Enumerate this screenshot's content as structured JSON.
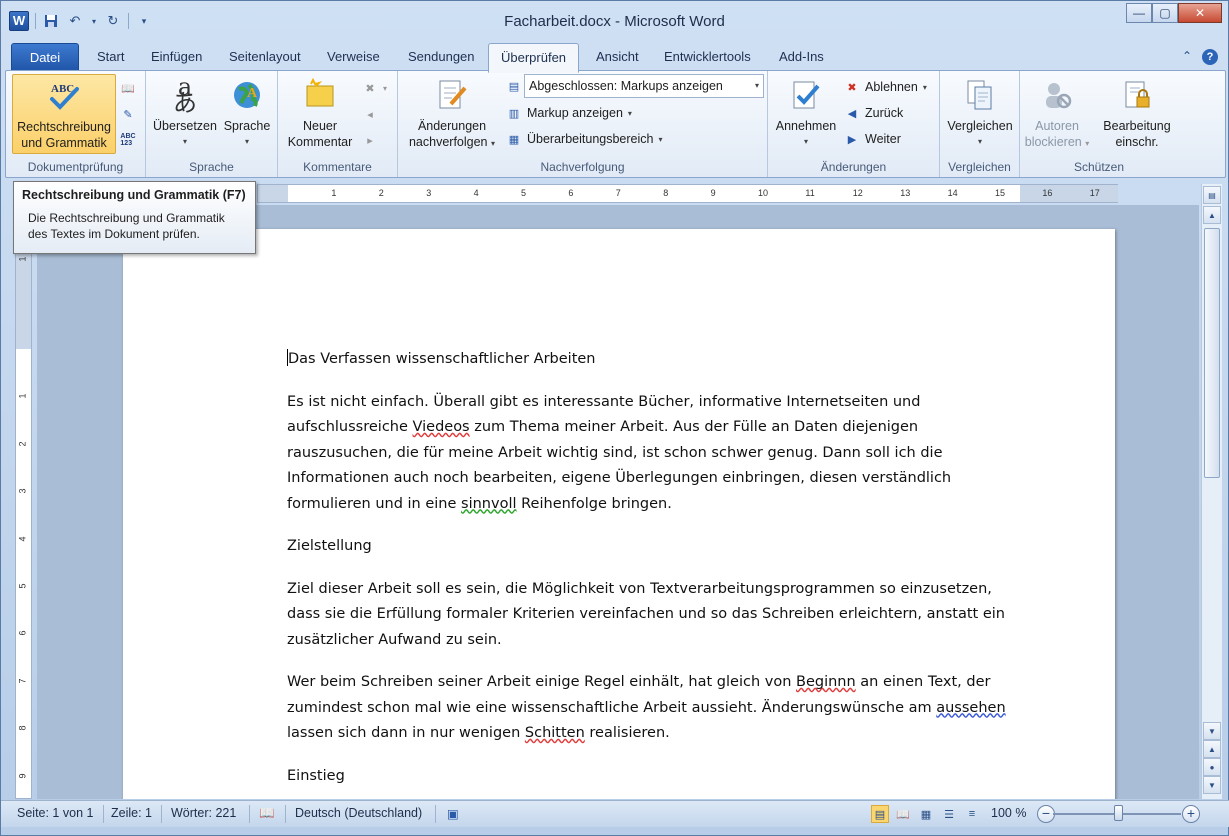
{
  "window": {
    "title": "Facharbeit.docx  -  Microsoft Word"
  },
  "qat": {
    "logo": "W",
    "save_icon": "save-icon",
    "undo_icon": "undo-icon",
    "redo_icon": "redo-icon"
  },
  "tabs": [
    "Datei",
    "Start",
    "Einfügen",
    "Seitenlayout",
    "Verweise",
    "Sendungen",
    "Überprüfen",
    "Ansicht",
    "Entwicklertools",
    "Add-Ins"
  ],
  "active_tab": "Überprüfen",
  "ribbon": {
    "dokumentpruefung": {
      "label": "Dokumentprüfung",
      "spell_label_1": "Rechtschreibung",
      "spell_label_2": "und Grammatik"
    },
    "sprache": {
      "label": "Sprache",
      "translate": "Übersetzen",
      "language": "Sprache"
    },
    "kommentare": {
      "label": "Kommentare",
      "new_1": "Neuer",
      "new_2": "Kommentar"
    },
    "nachverfolgung": {
      "label": "Nachverfolgung",
      "track_1": "Änderungen",
      "track_2": "nachverfolgen",
      "display_value": "Abgeschlossen: Markups anzeigen",
      "markup": "Markup anzeigen",
      "pane": "Überarbeitungsbereich"
    },
    "aenderungen": {
      "label": "Änderungen",
      "accept": "Annehmen",
      "reject": "Ablehnen",
      "previous": "Zurück",
      "next": "Weiter"
    },
    "vergleichen": {
      "label": "Vergleichen",
      "compare": "Vergleichen"
    },
    "schuetzen": {
      "label": "Schützen",
      "block_1": "Autoren",
      "block_2": "blockieren",
      "restrict_1": "Bearbeitung",
      "restrict_2": "einschr."
    }
  },
  "tooltip": {
    "title": "Rechtschreibung und Grammatik (F7)",
    "body_1": "Die Rechtschreibung und Grammatik",
    "body_2": "des Textes im Dokument prüfen."
  },
  "ruler": {
    "h_marks": [
      "1",
      "2",
      "3",
      "4",
      "5",
      "6",
      "7",
      "8",
      "9",
      "10",
      "11",
      "12",
      "13",
      "14",
      "15",
      "16",
      "17"
    ],
    "v_marks": [
      "1",
      "1",
      "2",
      "3",
      "4",
      "5",
      "6",
      "7",
      "8",
      "9"
    ]
  },
  "document": {
    "heading1": "Das Verfassen wissenschaftlicher Arbeiten",
    "p1_a": "Es ist nicht einfach. Überall gibt es interessante Bücher, informative Internetseiten und aufschlussreiche ",
    "p1_err1": "Viedeos",
    "p1_b": " zum Thema meiner Arbeit. Aus der Fülle an Daten diejenigen rauszusuchen, die für meine Arbeit wichtig sind, ist schon schwer genug. Dann soll ich die Informationen auch noch bearbeiten, eigene Überlegungen einbringen, diesen verständlich formulieren und in eine ",
    "p1_err2": "sinnvoll",
    "p1_c": " Reihenfolge bringen.",
    "heading2": "Zielstellung",
    "p2": "Ziel dieser Arbeit soll es sein, die Möglichkeit von Textverarbeitungsprogrammen so einzusetzen, dass sie die Erfüllung formaler Kriterien vereinfachen und so das Schreiben erleichtern, anstatt ein zusätzlicher Aufwand zu sein.",
    "p3_a": "Wer beim Schreiben seiner Arbeit einige Regel einhält, hat gleich von ",
    "p3_err1": "Beginnn",
    "p3_b": " an einen Text, der zumindest schon mal wie eine wissenschaftliche Arbeit aussieht. Änderungswünsche am ",
    "p3_err2": "aussehen",
    "p3_c": " lassen sich dann in nur wenigen ",
    "p3_err3": "Schitten",
    "p3_d": " realisieren.",
    "heading3": "Einstieg"
  },
  "status": {
    "page": "Seite: 1 von 1",
    "line": "Zeile: 1",
    "words": "Wörter: 221",
    "language": "Deutsch (Deutschland)",
    "zoom": "100 %"
  },
  "colors": {
    "accent": "#2c65b8",
    "highlight": "#fbd06a",
    "spell_error": "#e23b3b",
    "grammar_error": "#2aa52a",
    "context_error": "#3b58d8"
  }
}
